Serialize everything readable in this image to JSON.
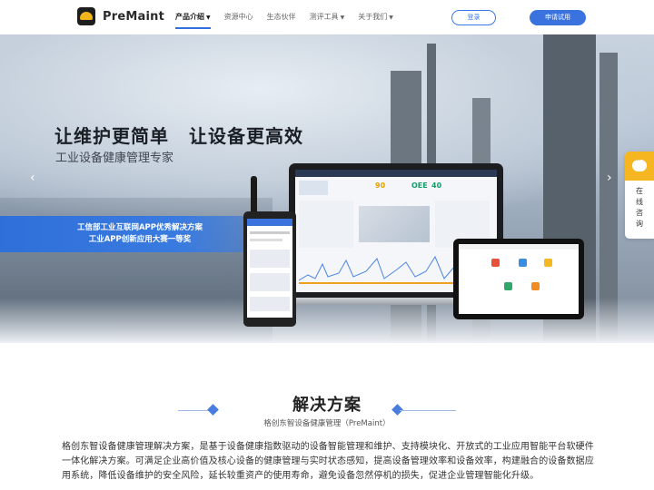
{
  "brand": {
    "name": "PreMaint"
  },
  "nav": {
    "items": [
      {
        "label": "产品介绍",
        "active": true,
        "dropdown": true
      },
      {
        "label": "资源中心",
        "active": false,
        "dropdown": false
      },
      {
        "label": "生态伙伴",
        "active": false,
        "dropdown": false
      },
      {
        "label": "测评工具",
        "active": false,
        "dropdown": true
      },
      {
        "label": "关于我们",
        "active": false,
        "dropdown": true
      }
    ],
    "login_label": "登录",
    "trial_label": "申请试用"
  },
  "hero": {
    "slogan_left": "让维护更简单",
    "slogan_right": "让设备更高效",
    "subtitle": "工业设备健康管理专家",
    "award_line1": "工信部工业互联网APP优秀解决方案",
    "award_line2": "工业APP创新应用大赛一等奖",
    "prev_icon": "chevron-left",
    "next_icon": "chevron-right"
  },
  "dashboard": {
    "metric1": "90",
    "metric2": "OEE",
    "metric3": "40"
  },
  "consult": {
    "label": "在线咨询",
    "icon": "chat-bubble"
  },
  "solution": {
    "title": "解决方案",
    "subtitle": "格创东智设备健康管理（PreMaint）",
    "body": "格创东智设备健康管理解决方案，是基于设备健康指数驱动的设备智能管理和维护、支持模块化、开放式的工业应用智能平台软硬件一体化解决方案。可满足企业高价值及核心设备的健康管理与实时状态感知，提高设备管理效率和设备效率，构建融合的设备数据应用系统，降低设备维护的安全风险，延长较重资产的使用寿命，避免设备忽然停机的损失，促进企业管理智能化升级。"
  },
  "colors": {
    "accent": "#3a73de",
    "award": "#2f6fd9",
    "consult": "#f5b621"
  }
}
